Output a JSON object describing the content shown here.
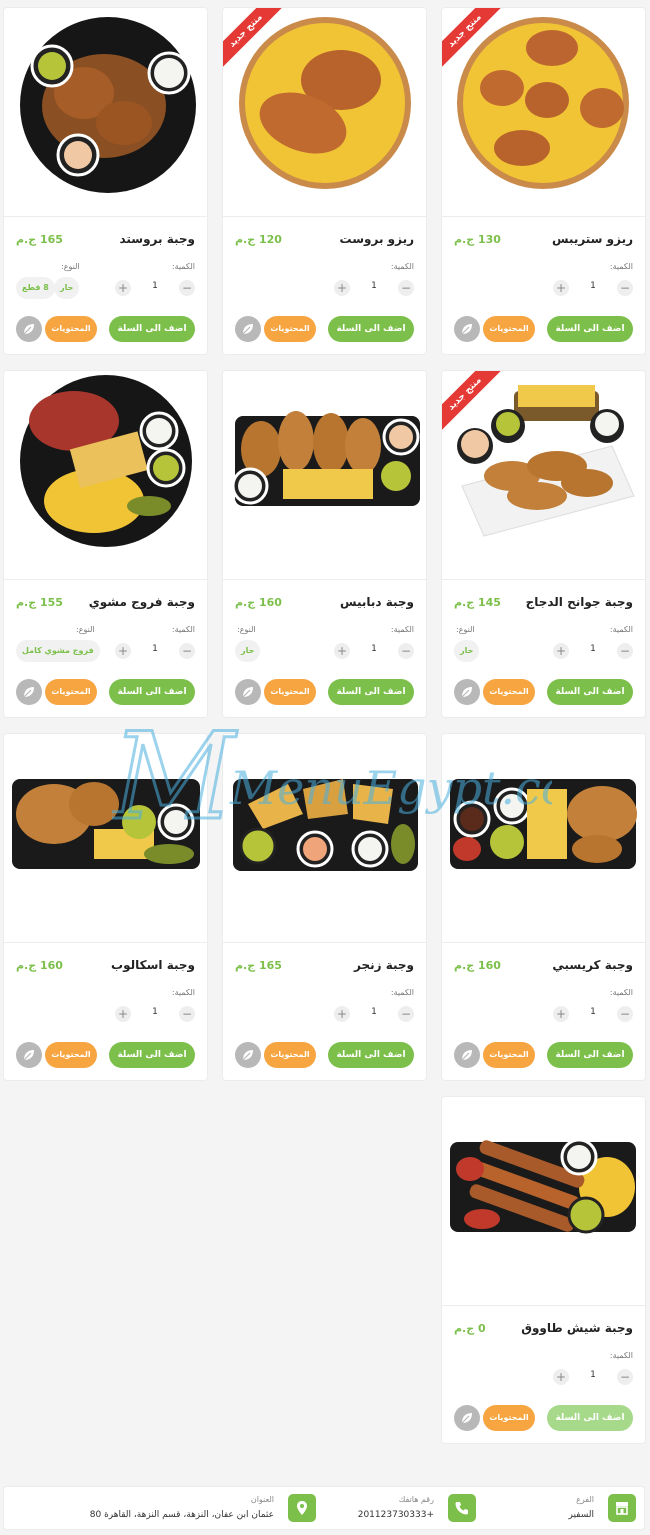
{
  "cards": [
    {
      "title": "وجبة بروستد",
      "price": "165 ج.م",
      "qty_label": "الكمية:",
      "qty": "1",
      "type_label": "النوع:",
      "options": [
        "حار",
        "8 قطع"
      ],
      "add_label": "اضف الى السلة",
      "contents_label": "المحتويات",
      "badge": ""
    },
    {
      "title": "ريزو بروست",
      "price": "120 ج.م",
      "qty_label": "الكمية:",
      "qty": "1",
      "type_label": "",
      "options": [],
      "add_label": "اضف الى السلة",
      "contents_label": "المحتويات",
      "badge": "منتج جديد"
    },
    {
      "title": "ريزو ستريبس",
      "price": "130 ج.م",
      "qty_label": "الكمية:",
      "qty": "1",
      "type_label": "",
      "options": [],
      "add_label": "اضف الى السلة",
      "contents_label": "المحتويات",
      "badge": "منتج جديد"
    },
    {
      "title": "وجبة فروج مشوي",
      "price": "155 ج.م",
      "qty_label": "الكمية:",
      "qty": "1",
      "type_label": "النوع:",
      "options": [
        "فروج مشوي كامل"
      ],
      "add_label": "اضف الى السلة",
      "contents_label": "المحتويات",
      "badge": ""
    },
    {
      "title": "وجبة دبابيس",
      "price": "160 ج.م",
      "qty_label": "الكمية:",
      "qty": "1",
      "type_label": "النوع:",
      "options": [
        "حار"
      ],
      "add_label": "اضف الى السلة",
      "contents_label": "المحتويات",
      "badge": ""
    },
    {
      "title": "وجبة جوانح الدجاج",
      "price": "145 ج.م",
      "qty_label": "الكمية:",
      "qty": "1",
      "type_label": "النوع:",
      "options": [
        "حار"
      ],
      "add_label": "اضف الى السلة",
      "contents_label": "المحتويات",
      "badge": "منتج جديد"
    },
    {
      "title": "وجبة اسكالوب",
      "price": "160 ج.م",
      "qty_label": "الكمية:",
      "qty": "1",
      "type_label": "",
      "options": [],
      "add_label": "اضف الى السلة",
      "contents_label": "المحتويات",
      "badge": ""
    },
    {
      "title": "وجبة زنجر",
      "price": "165 ج.م",
      "qty_label": "الكمية:",
      "qty": "1",
      "type_label": "",
      "options": [],
      "add_label": "اضف الى السلة",
      "contents_label": "المحتويات",
      "badge": ""
    },
    {
      "title": "وجبة كريسبي",
      "price": "160 ج.م",
      "qty_label": "الكمية:",
      "qty": "1",
      "type_label": "",
      "options": [],
      "add_label": "اضف الى السلة",
      "contents_label": "المحتويات",
      "badge": ""
    },
    {
      "title": "وجبة شيش طاووق",
      "price": "0 ج.م",
      "qty_label": "الكمية:",
      "qty": "1",
      "type_label": "",
      "options": [],
      "add_label": "اضف الى السلة",
      "contents_label": "المحتويات",
      "badge": ""
    }
  ],
  "stepper": {
    "minus": "−",
    "plus": "+"
  },
  "footer": {
    "branch_label": "الفرع",
    "branch_value": "السفير",
    "phone_label": "رقم هاتفك",
    "phone_value": "+201123730333",
    "address_label": "العنوان",
    "address_value": "عثمان ابن عفان، النزهة، قسم النزهة، القاهرة 80"
  },
  "watermark": "MenuEgypt.com",
  "colors": {
    "accent": "#7cc04b",
    "orange": "#f7a541",
    "badge": "#e53935"
  }
}
